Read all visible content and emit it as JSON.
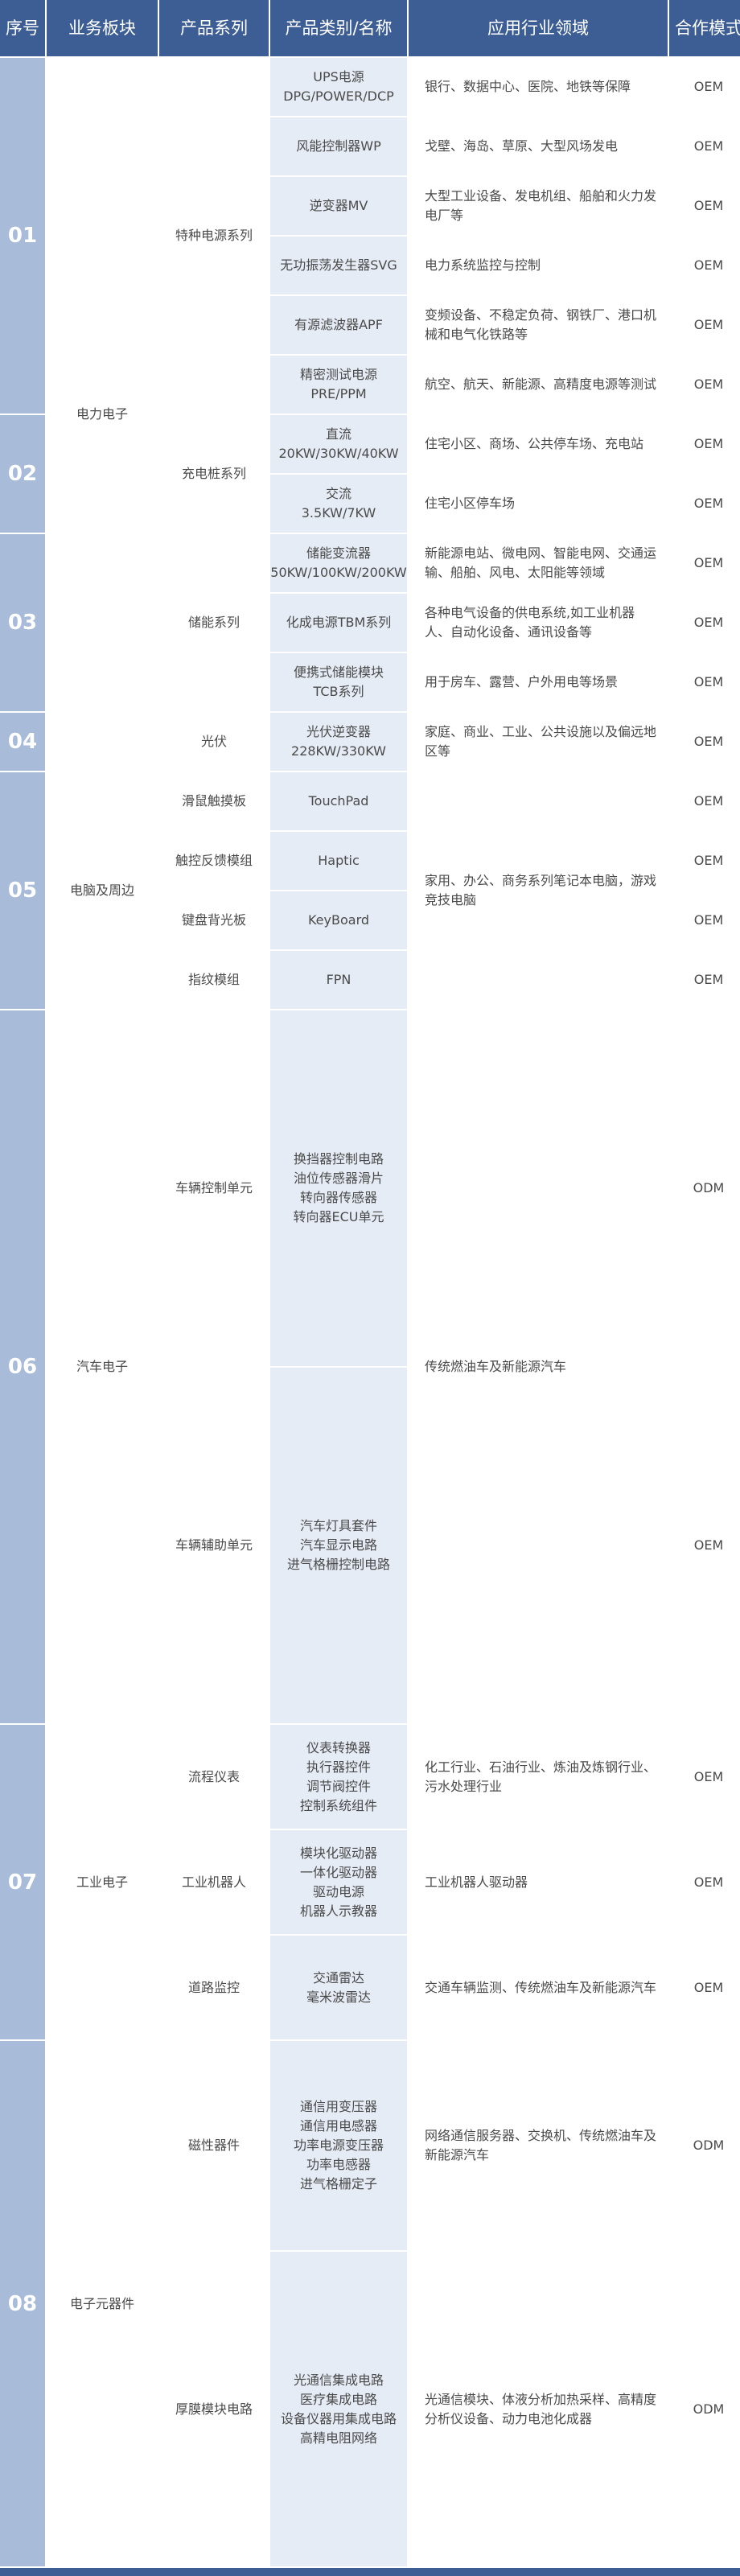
{
  "headers": {
    "seq": "序号",
    "sector": "业务板块",
    "series": "产品系列",
    "product": "产品类别/名称",
    "application": "应用行业领域",
    "mode": "合作模式"
  },
  "seq": [
    "01",
    "02",
    "03",
    "04",
    "05",
    "06",
    "07",
    "08"
  ],
  "sectors": [
    "电力电子",
    "电脑及周边",
    "汽车电子",
    "工业电子",
    "电子元器件"
  ],
  "series": [
    "特种电源系列",
    "充电桩系列",
    "储能系列",
    "光伏",
    "滑鼠触摸板",
    "触控反馈模组",
    "键盘背光板",
    "指纹模组",
    "车辆控制单元",
    "车辆辅助单元",
    "流程仪表",
    "工业机器人",
    "道路监控",
    "磁性器件",
    "厚膜模块电路"
  ],
  "products": [
    [
      "UPS电源",
      "DPG/POWER/DCP"
    ],
    [
      "风能控制器WP"
    ],
    [
      "逆变器MV"
    ],
    [
      "无功振荡发生器SVG"
    ],
    [
      "有源滤波器APF"
    ],
    [
      "精密测试电源",
      "PRE/PPM"
    ],
    [
      "直流",
      "20KW/30KW/40KW"
    ],
    [
      "交流",
      "3.5KW/7KW"
    ],
    [
      "储能变流器",
      "50KW/100KW/200KW"
    ],
    [
      "化成电源TBM系列"
    ],
    [
      "便携式储能模块",
      "TCB系列"
    ],
    [
      "光伏逆变器",
      "228KW/330KW"
    ],
    [
      "TouchPad"
    ],
    [
      "Haptic"
    ],
    [
      "KeyBoard"
    ],
    [
      "FPN"
    ],
    [
      "换挡器控制电路",
      "油位传感器滑片",
      "转向器传感器",
      "转向器ECU单元"
    ],
    [
      "汽车灯具套件",
      "汽车显示电路",
      "进气格栅控制电路"
    ],
    [
      "仪表转换器",
      "执行器控件",
      "调节阀控件",
      "控制系统组件"
    ],
    [
      "模块化驱动器",
      "一体化驱动器",
      "驱动电源",
      "机器人示教器"
    ],
    [
      "交通雷达",
      "毫米波雷达"
    ],
    [
      "通信用变压器",
      "通信用电感器",
      "功率电源变压器",
      "功率电感器",
      "进气格栅定子"
    ],
    [
      "光通信集成电路",
      "医疗集成电路",
      "设备仪器用集成电路",
      "高精电阻网络"
    ]
  ],
  "applications": [
    "银行、数据中心、医院、地铁等保障",
    "戈壁、海岛、草原、大型风场发电",
    "大型工业设备、发电机组、船舶和火力发电厂等",
    "电力系统监控与控制",
    "变频设备、不稳定负荷、钢铁厂、港口机械和电气化铁路等",
    "航空、航天、新能源、高精度电源等测试",
    "住宅小区、商场、公共停车场、充电站",
    "住宅小区停车场",
    "新能源电站、微电网、智能电网、交通运输、船舶、风电、太阳能等领域",
    "各种电气设备的供电系统,如工业机器人、自动化设备、通讯设备等",
    "用于房车、露营、户外用电等场景",
    "家庭、商业、工业、公共设施以及偏远地区等",
    "家用、办公、商务系列笔记本电脑，游戏竞技电脑",
    "传统燃油车及新能源汽车",
    "化工行业、石油行业、炼油及炼钢行业、污水处理行业",
    "工业机器人驱动器",
    "交通车辆监测、传统燃油车及新能源汽车",
    "网络通信服务器、交换机、传统燃油车及新能源汽车",
    "光通信模块、体液分析加热采样、高精度分析仪设备、动力电池化成器"
  ],
  "modes": [
    "OEM",
    "OEM",
    "OEM",
    "OEM",
    "OEM",
    "OEM",
    "OEM",
    "OEM",
    "OEM",
    "OEM",
    "OEM",
    "OEM",
    "OEM",
    "OEM",
    "OEM",
    "OEM",
    "ODM",
    "OEM",
    "OEM",
    "OEM",
    "OEM",
    "ODM",
    "ODM"
  ],
  "colors": {
    "header_bg": "#3d5e94",
    "seq_bg": "#a8bbd9",
    "product_bg": "#e6ecf5",
    "text": "#4a4a4a"
  }
}
